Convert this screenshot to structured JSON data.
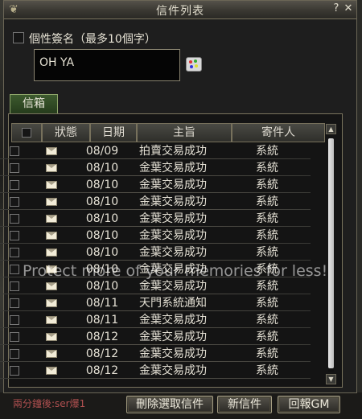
{
  "window": {
    "title": "信件列表",
    "help_label": "?",
    "close_label": "✕"
  },
  "signature": {
    "label": "個性簽名（最多10個字）",
    "value": "OH YA"
  },
  "tab": {
    "label": "信箱"
  },
  "columns": [
    "狀態",
    "日期",
    "主旨",
    "寄件人"
  ],
  "mails": [
    {
      "date": "08/09",
      "subject": "拍賣交易成功",
      "sender": "系統"
    },
    {
      "date": "08/10",
      "subject": "金葉交易成功",
      "sender": "系統"
    },
    {
      "date": "08/10",
      "subject": "金葉交易成功",
      "sender": "系統"
    },
    {
      "date": "08/10",
      "subject": "金葉交易成功",
      "sender": "系統"
    },
    {
      "date": "08/10",
      "subject": "金葉交易成功",
      "sender": "系統"
    },
    {
      "date": "08/10",
      "subject": "金葉交易成功",
      "sender": "系統"
    },
    {
      "date": "08/10",
      "subject": "金葉交易成功",
      "sender": "系統"
    },
    {
      "date": "08/10",
      "subject": "金葉交易成功",
      "sender": "系統"
    },
    {
      "date": "08/10",
      "subject": "金葉交易成功",
      "sender": "系統"
    },
    {
      "date": "08/11",
      "subject": "天門系統通知",
      "sender": "系統"
    },
    {
      "date": "08/11",
      "subject": "金葉交易成功",
      "sender": "系統"
    },
    {
      "date": "08/12",
      "subject": "金葉交易成功",
      "sender": "系統"
    },
    {
      "date": "08/12",
      "subject": "金葉交易成功",
      "sender": "系統"
    },
    {
      "date": "08/12",
      "subject": "金葉交易成功",
      "sender": "系統"
    }
  ],
  "scroll": {
    "up": "▲",
    "down": "▼"
  },
  "buttons": {
    "delete": "刪除選取信件",
    "new": "新信件",
    "reply_gm": "回報GM"
  },
  "chat_line": "兩分鐘後:ser爆1",
  "watermark": "Protect more of your memories for less!",
  "colors": {
    "panel_border": "#7a745e",
    "tab_green": "#3d5a2e",
    "chat_red": "#b05050"
  }
}
